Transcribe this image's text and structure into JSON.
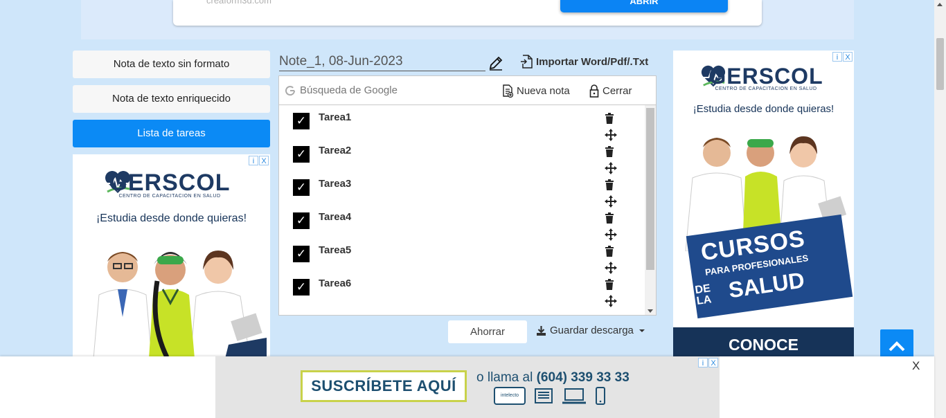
{
  "top_ad": {
    "url": "creaform3d.com",
    "button_label": "ABRIR"
  },
  "nav": [
    {
      "label": "Nota de texto sin formato",
      "active": false
    },
    {
      "label": "Nota de texto enriquecido",
      "active": false
    },
    {
      "label": "Lista de tareas",
      "active": true
    }
  ],
  "editor": {
    "note_title": "Note_1, 08-Jun-2023",
    "import_label": "Importar Word/Pdf/.Txt",
    "search_label": "Búsqueda de Google",
    "new_note_label": "Nueva nota",
    "close_label": "Cerrar",
    "tasks": [
      {
        "label": "Tarea1",
        "checked": true
      },
      {
        "label": "Tarea2",
        "checked": true
      },
      {
        "label": "Tarea3",
        "checked": true
      },
      {
        "label": "Tarea4",
        "checked": true
      },
      {
        "label": "Tarea5",
        "checked": true
      },
      {
        "label": "Tarea6",
        "checked": true
      }
    ],
    "check_glyph": "✓",
    "save_label": "Ahorrar",
    "download_label": "Guardar descarga"
  },
  "left_ad": {
    "brand": "GERSCOL",
    "brand_sub": "CENTRO DE CAPACITACION EN SALUD",
    "slogan": "¡Estudia desde donde quieras!",
    "choice_i": "i",
    "choice_x": "X"
  },
  "right_ad": {
    "brand": "GERSCOL",
    "brand_sub": "CENTRO DE CAPACITACION EN SALUD",
    "slogan": "¡Estudia desde donde quieras!",
    "banner_line1": "CURSOS",
    "banner_line2": "PARA PROFESIONALES",
    "banner_line3_small": "DE LA",
    "banner_line3": "SALUD",
    "cta": "CONOCE",
    "choice_i": "i",
    "choice_x": "X"
  },
  "bottom_ad": {
    "subscribe": "SUSCRÍBETE AQUÍ",
    "call_prefix": "o llama al",
    "phone": "(604) 339 33 33",
    "close": "X",
    "brand_small": "intelecto"
  },
  "colors": {
    "accent": "#0b8af5",
    "page_bg": "#cfe6fa",
    "ad_navy": "#163358"
  }
}
